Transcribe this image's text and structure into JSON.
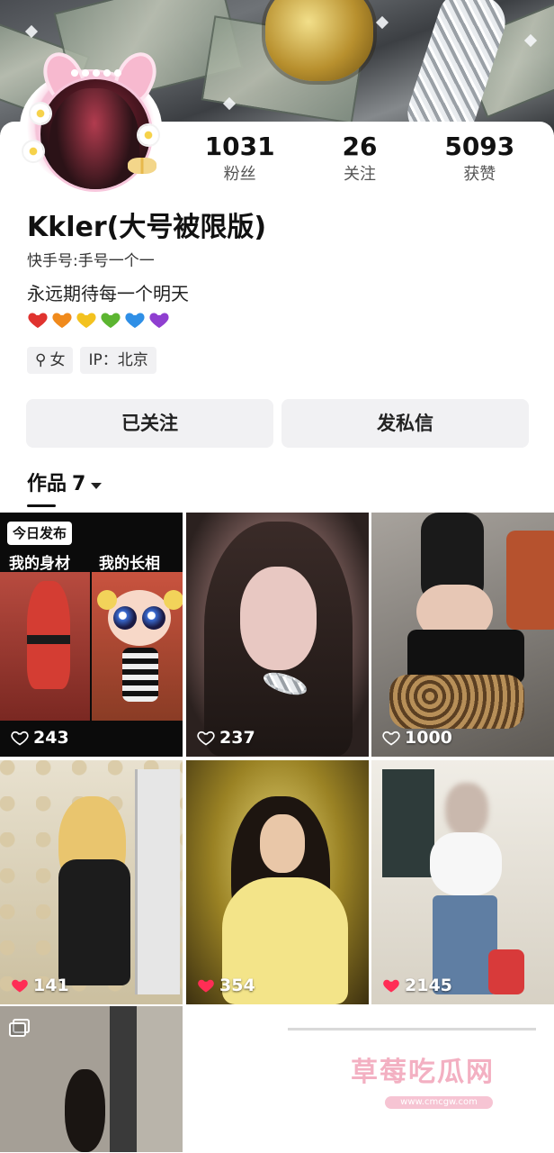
{
  "profile": {
    "stats": [
      {
        "value": "1031",
        "label": "粉丝"
      },
      {
        "value": "26",
        "label": "关注"
      },
      {
        "value": "5093",
        "label": "获赞"
      }
    ],
    "name": "Kkler(大号被限版)",
    "kuaishou_id": "快手号:手号一个一",
    "bio": "永远期待每一个明天",
    "hearts": [
      "#e0332f",
      "#f08a1c",
      "#f3c21f",
      "#5cb531",
      "#2f8fe6",
      "#8f3fd0"
    ],
    "tags": {
      "gender_icon": "female-icon",
      "gender": "女",
      "ip": "IP：北京"
    }
  },
  "actions": {
    "follow_label": "已关注",
    "message_label": "发私信"
  },
  "works": {
    "label": "作品",
    "count": "7",
    "items": [
      {
        "likes": "243",
        "badge": "今日发布",
        "caption_left": "我的身材",
        "caption_right": "我的长相",
        "liked": false
      },
      {
        "likes": "237",
        "liked": false
      },
      {
        "likes": "1000",
        "liked": false
      },
      {
        "likes": "141",
        "liked": true
      },
      {
        "likes": "354",
        "liked": true
      },
      {
        "likes": "2145",
        "liked": true
      },
      {
        "gallery_icon": "gallery-icon"
      }
    ]
  },
  "watermark": {
    "text": "草莓吃瓜网",
    "url": "www.cmcgw.com"
  },
  "colors": {
    "heart_red": "#ff2d55",
    "button_bg": "#f1f1f3",
    "watermark": "#f3b0c2"
  }
}
